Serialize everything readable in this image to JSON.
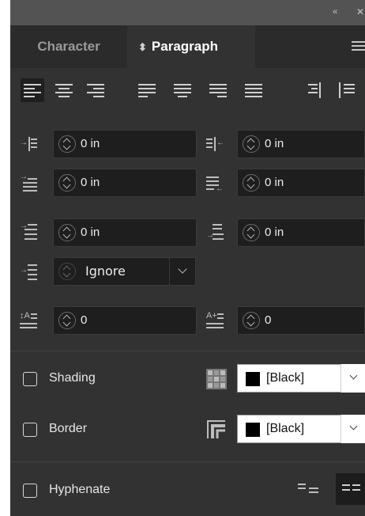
{
  "window": {
    "collapse_glyph": "‹‹",
    "close_glyph": "✕"
  },
  "tabs": [
    {
      "label": "Character",
      "active": false
    },
    {
      "label": "Paragraph",
      "active": true,
      "icon": "up-down-arrows-icon"
    }
  ],
  "alignment_buttons": [
    {
      "name": "align-left",
      "selected": true
    },
    {
      "name": "align-center",
      "selected": false
    },
    {
      "name": "align-right",
      "selected": false
    },
    {
      "name": "justify-left",
      "selected": false
    },
    {
      "name": "justify-center",
      "selected": false
    },
    {
      "name": "justify-right",
      "selected": false
    },
    {
      "name": "justify-all",
      "selected": false
    },
    {
      "name": "align-toward-spine",
      "selected": false
    },
    {
      "name": "align-away-from-spine",
      "selected": false
    }
  ],
  "fields": {
    "left_indent": "0 in",
    "right_indent": "0 in",
    "first_line_indent": "0 in",
    "last_line_right_indent": "0 in",
    "space_before": "0 in",
    "space_after": "0 in",
    "align_to_grid": "Ignore",
    "drop_cap_lines": "0",
    "drop_cap_characters": "0"
  },
  "options": {
    "shading": {
      "label": "Shading",
      "checked": false,
      "swatch": "[Black]"
    },
    "border": {
      "label": "Border",
      "checked": false,
      "swatch": "[Black]"
    },
    "hyphenate": {
      "label": "Hyphenate",
      "checked": false
    }
  },
  "colors": {
    "panel_bg": "#323232",
    "header_bg": "#535353",
    "field_bg": "#1e1e1e",
    "swatch": "#000000"
  }
}
